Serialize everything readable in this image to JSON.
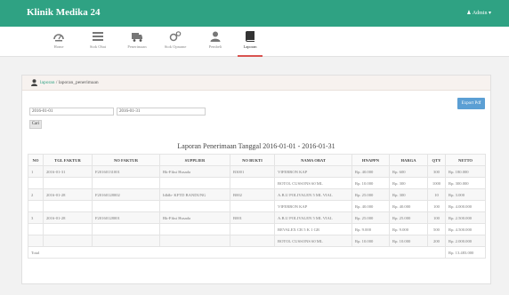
{
  "app": {
    "title": "Klinik Medika 24",
    "user": "Admin"
  },
  "nav": [
    {
      "label": "Home",
      "icon": "gauge-icon"
    },
    {
      "label": "Stok Obat",
      "icon": "list-icon"
    },
    {
      "label": "Penerimaan",
      "icon": "truck-icon"
    },
    {
      "label": "Stok Opname",
      "icon": "gears-icon"
    },
    {
      "label": "Pembeli",
      "icon": "user-icon"
    },
    {
      "label": "Laporan",
      "icon": "book-icon",
      "active": true
    }
  ],
  "breadcrumb": {
    "link": "laporan",
    "separator": " / ",
    "current": "laporan_penerimaan"
  },
  "filters": {
    "start_date": "2016-01-01",
    "end_date": "2016-01-31",
    "search_label": "Cari",
    "export_label": "Export Pdf"
  },
  "report_title": "Laporan Penerimaan Tanggal 2016-01-01 - 2016-01-31",
  "table": {
    "headers": [
      "NO",
      "TGL FAKTUR",
      "NO FAKTUR",
      "SUPPLIER",
      "NO BUKTI",
      "NAMA OBAT",
      "HNAPPN",
      "HARGA",
      "QTY",
      "NETTO"
    ],
    "rows": [
      [
        "1",
        "2016-01-31",
        "F20160131001",
        "Bk-Fiksi Husada",
        "B3001",
        "VIFERRON KAP",
        "Rp. 40.000",
        "Rp. 600",
        "300",
        "Rp. 180.000"
      ],
      [
        "",
        "",
        "",
        "",
        "",
        "BOTOL CUSSONS 60 ML",
        "Rp. 10.000",
        "Rp. 300",
        "1000",
        "Rp. 300.000"
      ],
      [
        "2",
        "2016-01-28",
        "F20160128002",
        "Idldb- KFTD BANDUNG",
        "B002",
        "A.B.U POLIVALEN 5 ML VIAL",
        "Rp. 25.000",
        "Rp. 300",
        "10",
        "Rp. 3.000"
      ],
      [
        "",
        "",
        "",
        "",
        "",
        "VIFERRON KAP",
        "Rp. 40.000",
        "Rp. 40.000",
        "100",
        "Rp. 4.000.000"
      ],
      [
        "3",
        "2016-01-28",
        "F20160128001",
        "Bk-Fiksi Husada",
        "B001",
        "A.B.U POLIVALEN 5 ML VIAL",
        "Rp. 25.000",
        "Rp. 25.000",
        "100",
        "Rp. 2.500.000"
      ],
      [
        "",
        "",
        "",
        "",
        "",
        "BEVALEX CR 5 K 1 GR",
        "Rp. 9.000",
        "Rp. 9.000",
        "500",
        "Rp. 4.500.000"
      ],
      [
        "",
        "",
        "",
        "",
        "",
        "BOTOL CUSSONS 60 ML",
        "Rp. 10.000",
        "Rp. 10.000",
        "200",
        "Rp. 2.000.000"
      ]
    ],
    "total_label": "Total",
    "total_value": "Rp. 13.483.000"
  },
  "colors": {
    "topbar": "#2fa283",
    "active_tab": "#d9534f",
    "export_button": "#5b9fd4"
  }
}
